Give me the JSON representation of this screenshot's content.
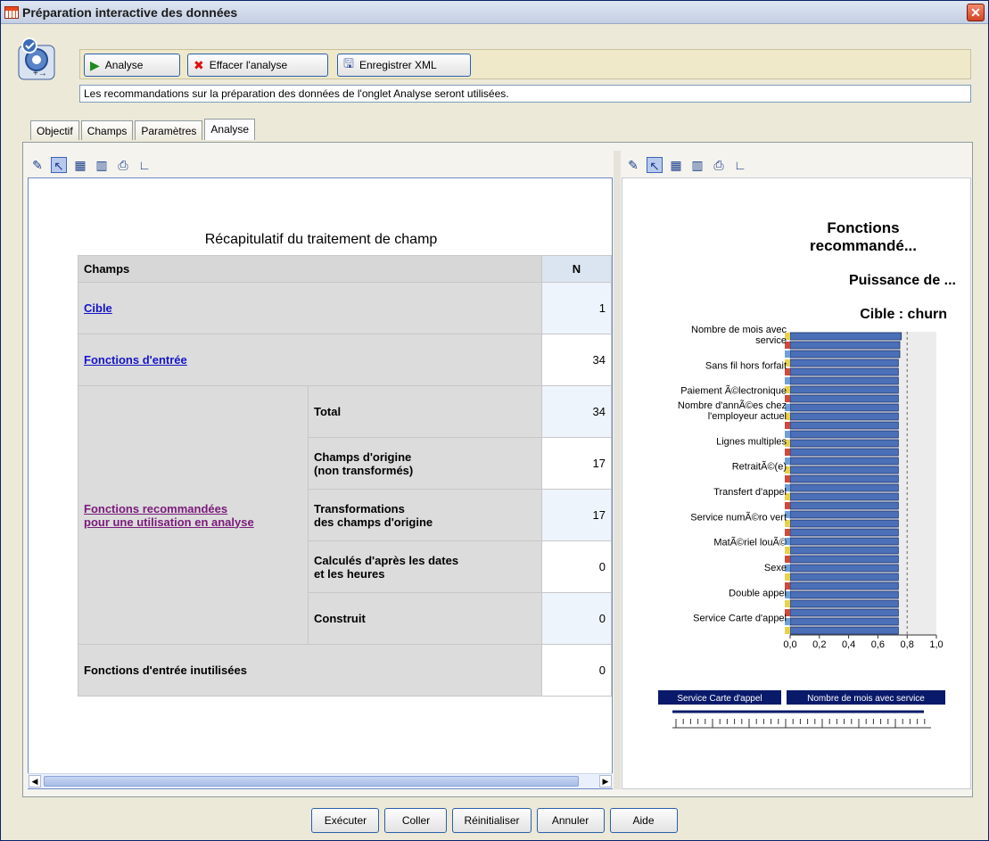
{
  "window": {
    "title": "Préparation interactive des données"
  },
  "toolbar": {
    "analyze_label": "Analyse",
    "clear_label": "Effacer l'analyse",
    "save_xml_label": "Enregistrer XML"
  },
  "info_message": "Les recommandations sur la préparation des données de l'onglet Analyse seront utilisées.",
  "tabs": [
    {
      "label": "Objectif"
    },
    {
      "label": "Champs"
    },
    {
      "label": "Paramètres"
    },
    {
      "label": "Analyse",
      "active": true
    }
  ],
  "left_table": {
    "title": "Récapitulatif du traitement de champ",
    "col_field": "Champs",
    "col_n": "N",
    "rows": {
      "target": {
        "label": "Cible",
        "n": "1"
      },
      "inputs": {
        "label": "Fonctions d'entrée",
        "n": "34"
      },
      "recommended": {
        "label_line1": "Fonctions recommandées",
        "label_line2": "pour une utilisation en analyse",
        "sub": [
          {
            "label_line1": "Total",
            "label_line2": "",
            "n": "34"
          },
          {
            "label_line1": "Champs d'origine",
            "label_line2": "(non transformés)",
            "n": "17"
          },
          {
            "label_line1": "Transformations",
            "label_line2": "des champs d'origine",
            "n": "17"
          },
          {
            "label_line1": "Calculés d'après les dates",
            "label_line2": "et les heures",
            "n": "0"
          },
          {
            "label_line1": "Construit",
            "label_line2": "",
            "n": "0"
          }
        ]
      },
      "unused": {
        "label": "Fonctions d'entrée inutilisées",
        "n": "0"
      }
    }
  },
  "right_chart": {
    "title_line1": "Fonctions",
    "title_line2": "recommandé...",
    "subtitle": "Puissance de ...",
    "target_label": "Cible : churn",
    "slider_left_label": "Service Carte d'appel",
    "slider_right_label": "Nombre de mois avec service"
  },
  "chart_data": {
    "type": "bar",
    "orientation": "horizontal",
    "xlim": [
      0,
      1
    ],
    "ticks": [
      "0,0",
      "0,2",
      "0,4",
      "0,6",
      "0,8",
      "1,0"
    ],
    "reference_line": 0.8,
    "labeled_categories": [
      "Nombre de mois avec service",
      "Sans fil hors forfait",
      "Paiement Ã©lectronique",
      "Nombre d'annÃ©es chez l'employeur actuel",
      "Lignes multiples",
      "RetraitÃ©(e)",
      "Transfert d'appel",
      "Service numÃ©ro vert",
      "MatÃ©riel louÃ©",
      "Sexe",
      "Double appel",
      "Service Carte d'appel"
    ],
    "values": [
      0.76,
      0.75,
      0.75,
      0.74,
      0.74,
      0.74,
      0.74,
      0.74,
      0.74,
      0.74,
      0.74,
      0.74,
      0.74,
      0.74,
      0.74,
      0.74,
      0.74,
      0.74,
      0.74,
      0.74,
      0.74,
      0.74,
      0.74,
      0.74,
      0.74,
      0.74,
      0.74,
      0.74,
      0.74,
      0.74,
      0.74,
      0.74,
      0.74,
      0.74
    ],
    "colors": {
      "bar": "#4b70b8",
      "bar_border": "#1a2f6a",
      "background": "#ececec"
    }
  },
  "buttons": {
    "run": "Exécuter",
    "paste": "Coller",
    "reset": "Réinitialiser",
    "cancel": "Annuler",
    "help": "Aide"
  }
}
